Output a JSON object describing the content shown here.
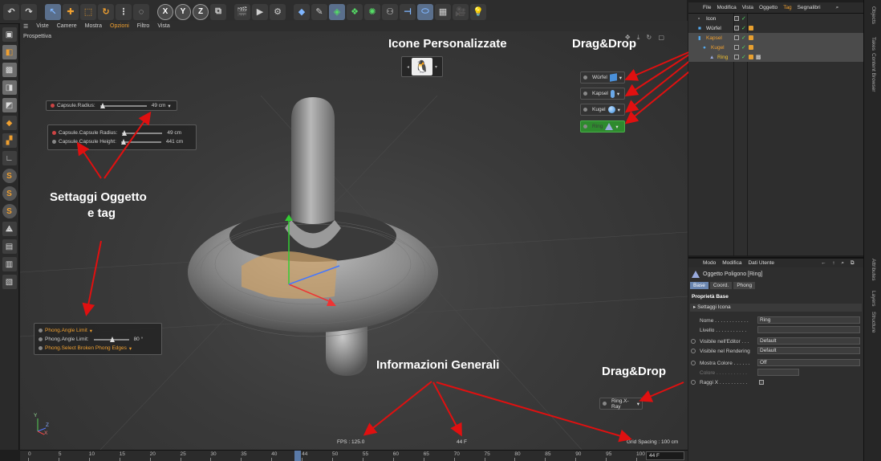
{
  "toolbar": {
    "icons": [
      "undo-icon",
      "redo-icon",
      "select-icon",
      "move-icon",
      "scale-icon",
      "rotate-icon",
      "recent-tools-icon",
      "live-select-icon"
    ],
    "axes": [
      "X",
      "Y",
      "Z"
    ],
    "render_icons": [
      "world-icon",
      "render-view-icon",
      "render-icon",
      "render-settings-icon"
    ],
    "object_icons": [
      "cube-icon",
      "pen-icon",
      "subdivision-icon",
      "array-icon",
      "cloner-icon",
      "deformer-icon",
      "floor-icon",
      "camera-icon",
      "light-icon"
    ]
  },
  "viewport": {
    "menu": [
      "Viste",
      "Camere",
      "Mostra",
      "Opzioni",
      "Filtro",
      "Vista"
    ],
    "menu_highlight": "Opzioni",
    "title": "Prospettiva",
    "fps": "FPS : 125.0",
    "frame": "44 F",
    "grid_spacing": "Grid Spacing : 100 cm",
    "axis_y": "Y",
    "axis_z": "Z",
    "axis_x": "X"
  },
  "hud": {
    "capsule_radius_label": "Capsule.Radius:",
    "capsule_radius_value": "49 cm",
    "capsule_capsule_radius_label": "Capsule.Capsule Radius:",
    "capsule_capsule_radius_value": "49 cm",
    "capsule_height_label": "Capsule.Capsule Height:",
    "capsule_height_value": "441 cm",
    "phong_limit": "Phong.Angle Limit",
    "phong_angle_label": "Phong.Angle Limit:",
    "phong_angle_value": "80 °",
    "phong_broken": "Phong.Select Broken Phong Edges"
  },
  "drag_items": [
    {
      "label": "Würfel"
    },
    {
      "label": "Kapsel"
    },
    {
      "label": "Kugel"
    },
    {
      "label": "Ring"
    }
  ],
  "xray_item": "Ring.X-Ray",
  "annotations": {
    "icone": "Icone Personalizzate",
    "dragdrop_top": "Drag&Drop",
    "settaggi_1": "Settaggi Oggetto",
    "settaggi_2": "e tag",
    "informazioni": "Informazioni Generali",
    "dragdrop_bottom": "Drag&Drop"
  },
  "timeline": {
    "ticks": [
      "0",
      "5",
      "10",
      "15",
      "20",
      "25",
      "30",
      "35",
      "40",
      "44",
      "50",
      "55",
      "60",
      "65",
      "70",
      "75",
      "80",
      "85",
      "90",
      "95",
      "100"
    ],
    "frame_field": "44 F"
  },
  "object_manager": {
    "menu": [
      "File",
      "Modifica",
      "Vista",
      "Oggetto",
      "Tag",
      "Segnalibri"
    ],
    "menu_highlight": "Tag",
    "rows": [
      {
        "name": "Icon",
        "indent": 0,
        "color": "#e8e8e8"
      },
      {
        "name": "Würfel",
        "indent": 1,
        "color": "#e8e8e8"
      },
      {
        "name": "Kapsel",
        "indent": 1,
        "color": "#f0a030"
      },
      {
        "name": "Kugel",
        "indent": 2,
        "color": "#f0a030"
      },
      {
        "name": "Ring",
        "indent": 3,
        "color": "#f0c030"
      }
    ]
  },
  "side_tabs": [
    "Objects",
    "Takes",
    "Content Browser",
    "Attributes",
    "Layers",
    "Structure"
  ],
  "attributes": {
    "menu": [
      "Modo",
      "Modifica",
      "Dati Utente"
    ],
    "title": "Oggetto Poligono [Ring]",
    "tabs": [
      "Base",
      "Coord.",
      "Phong"
    ],
    "active_tab": "Base",
    "section": "Proprietà Base",
    "subsection": "▸ Settaggi Icona",
    "rows": [
      {
        "label": "Nome . . . . . . . . . . . .",
        "value": "Ring"
      },
      {
        "label": "Livello . . . . . . . . . . .",
        "value": ""
      },
      {
        "label": "Visibile nell'Editor . . .",
        "value": "Default"
      },
      {
        "label": "Visibile nel Rendering",
        "value": "Default"
      },
      {
        "label": "Mostra Colore . . . . . .",
        "value": "Off"
      },
      {
        "label": "Colore . . . . . . . . . . .",
        "value": ""
      },
      {
        "label": "Raggi X . . . . . . . . . .",
        "value": ""
      }
    ]
  },
  "colors": {
    "accent": "#f0a030",
    "selection": "#5a6f8c",
    "arrow": "#e01010",
    "hud_green": "#2e8a2e"
  }
}
